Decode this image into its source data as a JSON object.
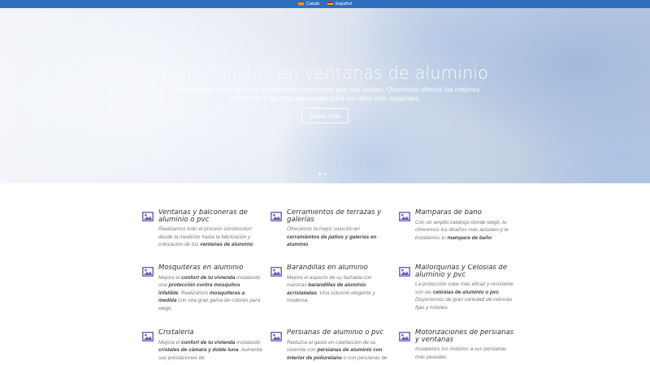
{
  "languages": [
    {
      "label": "Català",
      "flag": "catalan-flag-icon"
    },
    {
      "label": "Español",
      "flag": "spanish-flag-icon"
    }
  ],
  "hero": {
    "title": "Especialistas en ventanas de aluminio",
    "subtitle": "Tenemos más de 15 años de experiencia en el sector que nos avalan. Queremos ofrecer las mejores soluciones y las más adecuadas para los retos más exigentes.",
    "button_label": "Saber más",
    "slides": 2,
    "active_slide": 1
  },
  "colors": {
    "topbar": "#2f6fbd",
    "icon": "#6a5bbd",
    "title": "#333333",
    "text": "#777777"
  },
  "services": [
    {
      "icon": "image-icon",
      "title": "Ventanas y balconeras de aluminio o pvc",
      "text": [
        {
          "t": "Realizamos todo el proceso constructivo desde la medición hasta la fabricación y colocación de tus "
        },
        {
          "t": "ventanas de aluminio",
          "b": true
        }
      ]
    },
    {
      "icon": "image-icon",
      "title": "Cerramientos de terrazas y galerías",
      "text": [
        {
          "t": "Ofrecemos la mejor solución en "
        },
        {
          "t": "cerramientos de patios y galerías en aluminio",
          "b": true
        }
      ]
    },
    {
      "icon": "image-icon",
      "title": "Mamparas de baño",
      "text": [
        {
          "t": "Con un amplio catálogo donde elegir, te ofrecemos los diseños más actuales y te instalamos tu "
        },
        {
          "t": "mampara de baño",
          "b": true
        }
      ]
    },
    {
      "icon": "image-icon",
      "title": "Mosquiteras en aluminio",
      "text": [
        {
          "t": "Mejora el "
        },
        {
          "t": "confort de tu vivienda",
          "b": true
        },
        {
          "t": " instalando una "
        },
        {
          "t": "protección contra mosquitos infalible",
          "b": true
        },
        {
          "t": ". Realizamos "
        },
        {
          "t": "mosquiteras a medida",
          "b": true
        },
        {
          "t": " con una gran gama de colores para elegir."
        }
      ]
    },
    {
      "icon": "image-icon",
      "title": "Barandillas en aluminio",
      "text": [
        {
          "t": "Mejore el aspecto de su fachada con nuestras "
        },
        {
          "t": "barandillas de aluminio acristaladas",
          "b": true
        },
        {
          "t": ". Una solución elegante y moderna."
        }
      ]
    },
    {
      "icon": "image-icon",
      "title": "Mallorquinas y Celosías de aluminio y pvc",
      "text": [
        {
          "t": "La protección solar más eficaz y resistente son las "
        },
        {
          "t": "celosías de aluminio o pvc",
          "b": true
        },
        {
          "t": ". Disponemos de gran variedad de celosías fijas y móviles"
        }
      ]
    },
    {
      "icon": "image-icon",
      "title": "Cristalería",
      "text": [
        {
          "t": "Mejora el "
        },
        {
          "t": "confort de tu vivienda",
          "b": true
        },
        {
          "t": " instalando "
        },
        {
          "t": "cristales de cámara y doble luna",
          "b": true
        },
        {
          "t": ". Aumenta sus prestaciones de"
        }
      ]
    },
    {
      "icon": "image-icon",
      "title": "Persianas de aluminio o pvc",
      "text": [
        {
          "t": "Reduzca el gasto en calefacción de su vivienda con "
        },
        {
          "t": "persianas de aluminio con interior de poliuretano",
          "b": true
        },
        {
          "t": " o con persianas de"
        }
      ]
    },
    {
      "icon": "image-icon",
      "title": "Motorizaciones de persianas y ventanas",
      "text": [
        {
          "t": "Instalamos los motores a sus persianas más pesadas."
        }
      ]
    }
  ]
}
